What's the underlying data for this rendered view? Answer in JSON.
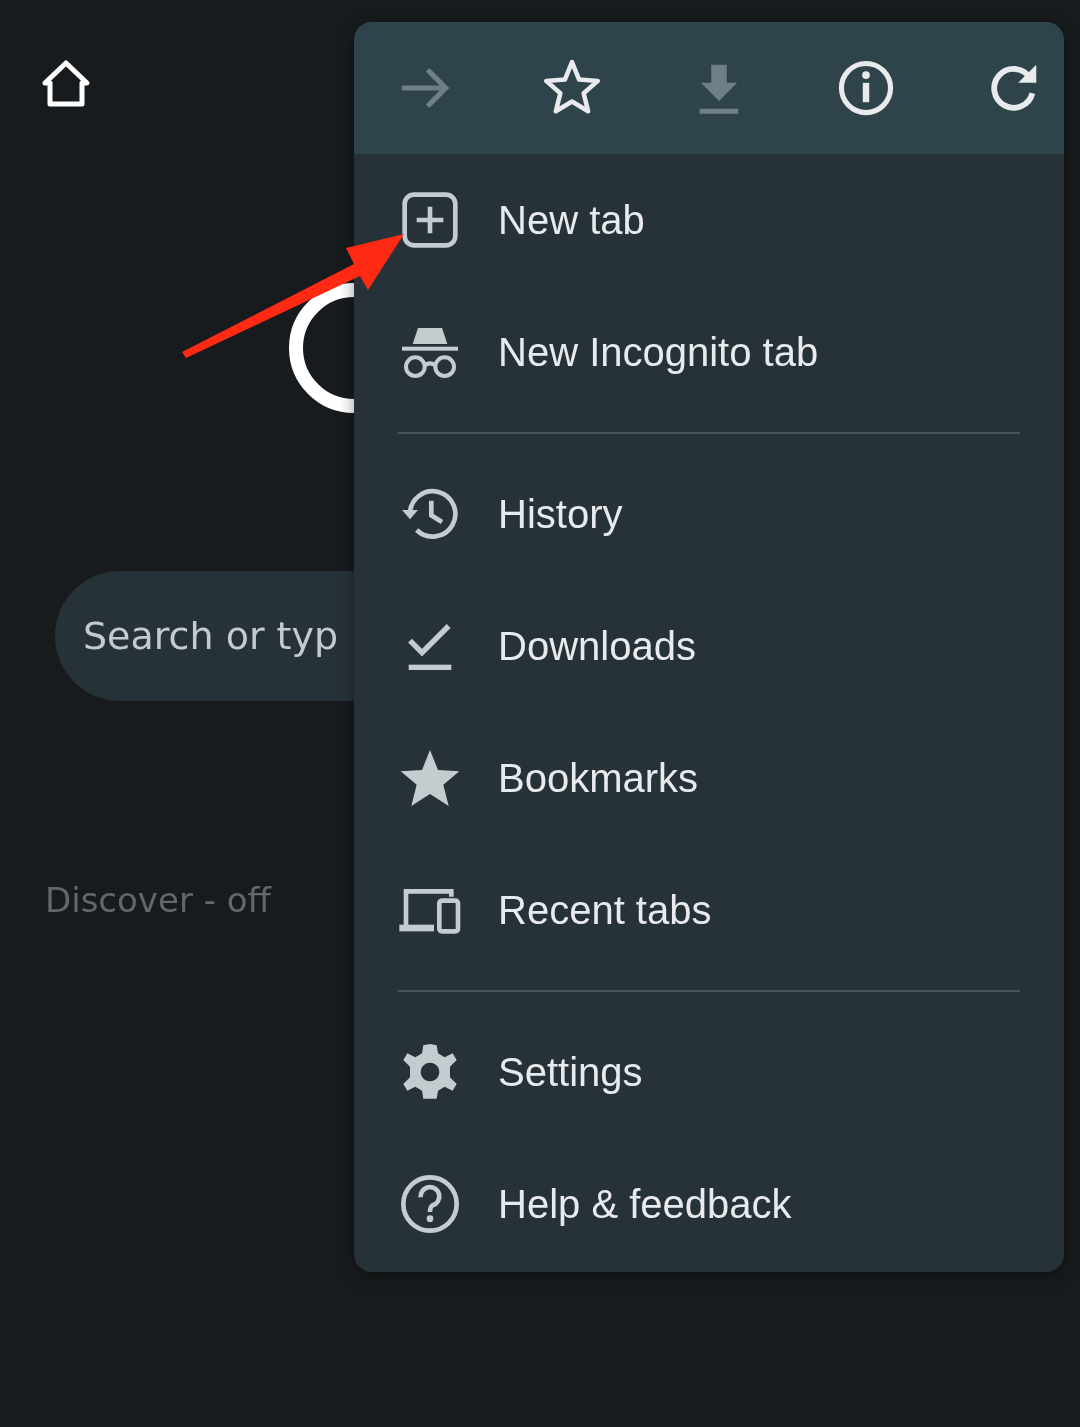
{
  "search": {
    "placeholder": "Search or typ"
  },
  "discover": "Discover - off",
  "menu": {
    "toolbar": [
      {
        "kind": "forward",
        "disabled": true
      },
      {
        "kind": "bookmark",
        "disabled": false
      },
      {
        "kind": "download",
        "disabled": true
      },
      {
        "kind": "info",
        "disabled": false
      },
      {
        "kind": "reload",
        "disabled": false
      }
    ],
    "sections": [
      [
        {
          "kind": "new-tab",
          "label": "New tab"
        },
        {
          "kind": "incognito",
          "label": "New Incognito tab"
        }
      ],
      [
        {
          "kind": "history",
          "label": "History"
        },
        {
          "kind": "downloads",
          "label": "Downloads"
        },
        {
          "kind": "bookmarks",
          "label": "Bookmarks"
        },
        {
          "kind": "recent",
          "label": "Recent tabs"
        }
      ],
      [
        {
          "kind": "settings",
          "label": "Settings"
        },
        {
          "kind": "help",
          "label": "Help & feedback"
        }
      ]
    ]
  }
}
